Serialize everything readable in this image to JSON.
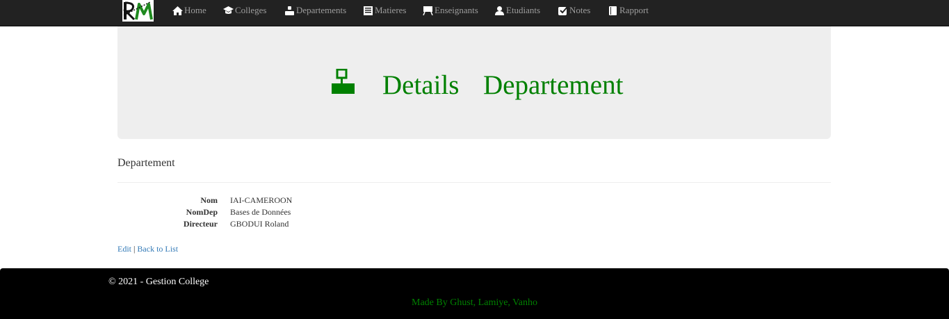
{
  "navbar": {
    "logo_text": "RM",
    "items": [
      {
        "label": "Home",
        "icon": "home-icon"
      },
      {
        "label": "Colleges",
        "icon": "graduation-cap-icon"
      },
      {
        "label": "Departements",
        "icon": "user-badge-icon"
      },
      {
        "label": "Matieres",
        "icon": "list-alt-icon"
      },
      {
        "label": "Enseignants",
        "icon": "blackboard-icon"
      },
      {
        "label": "Etudiants",
        "icon": "user-icon"
      },
      {
        "label": "Notes",
        "icon": "check-icon"
      },
      {
        "label": "Rapport",
        "icon": "book-icon"
      }
    ]
  },
  "jumbotron": {
    "icon": "sitemap-icon",
    "word1": "Details",
    "word2": "Departement",
    "color": "#008000"
  },
  "details": {
    "title": "Departement",
    "fields": [
      {
        "label": "Nom",
        "value": "IAI-CAMEROON"
      },
      {
        "label": "NomDep",
        "value": "Bases de Données"
      },
      {
        "label": "Directeur",
        "value": "GBODUI Roland"
      }
    ]
  },
  "actions": {
    "edit_label": "Edit",
    "separator": "|",
    "back_label": "Back to List"
  },
  "footer": {
    "copyright": "© 2021 - Gestion College",
    "credits": "Made By Ghust, Lamiye, Vanho"
  }
}
